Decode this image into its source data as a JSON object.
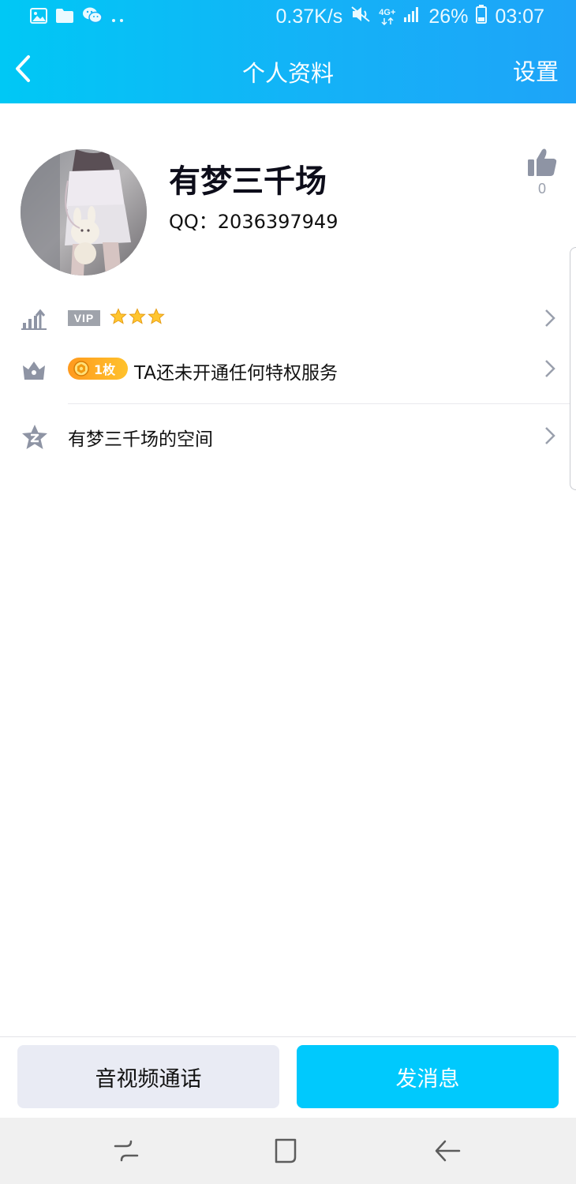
{
  "status_bar": {
    "net_speed": "0.37K/s",
    "net_type": "4G+",
    "battery": "26%",
    "time": "03:07",
    "left_icons": [
      "gallery-icon",
      "folder-icon",
      "wechat-icon",
      "more-dots-icon"
    ],
    "right_icons": [
      "mute-icon",
      "network-4g-icon",
      "signal-icon",
      "battery-icon"
    ]
  },
  "navbar": {
    "title": "个人资料",
    "settings_label": "设置",
    "back_icon": "chevron-left-icon"
  },
  "profile": {
    "nickname": "有梦三千场",
    "qq_line": "QQ：2036397949",
    "like_count": "0",
    "like_icon": "thumbs-up-icon"
  },
  "rows": {
    "vip": {
      "badge": "VIP",
      "stars": 3,
      "icon": "level-chart-icon"
    },
    "privilege": {
      "coin_label": "1枚",
      "text": "TA还未开通任何特权服务",
      "icon": "crown-icon"
    },
    "space": {
      "text": "有梦三千场的空间",
      "icon": "qzone-star-icon"
    }
  },
  "actions": {
    "call_label": "音视频通话",
    "message_label": "发消息"
  },
  "system_nav": {
    "icons": [
      "recent-apps-icon",
      "home-icon",
      "back-icon"
    ]
  },
  "colors": {
    "header_start": "#00c8f5",
    "header_end": "#1ea4f8",
    "primary_button": "#00c9fd",
    "secondary_button": "#e9ebf4",
    "icon_gray": "#9aa0ad",
    "coin_orange": "#ff9a1e"
  }
}
